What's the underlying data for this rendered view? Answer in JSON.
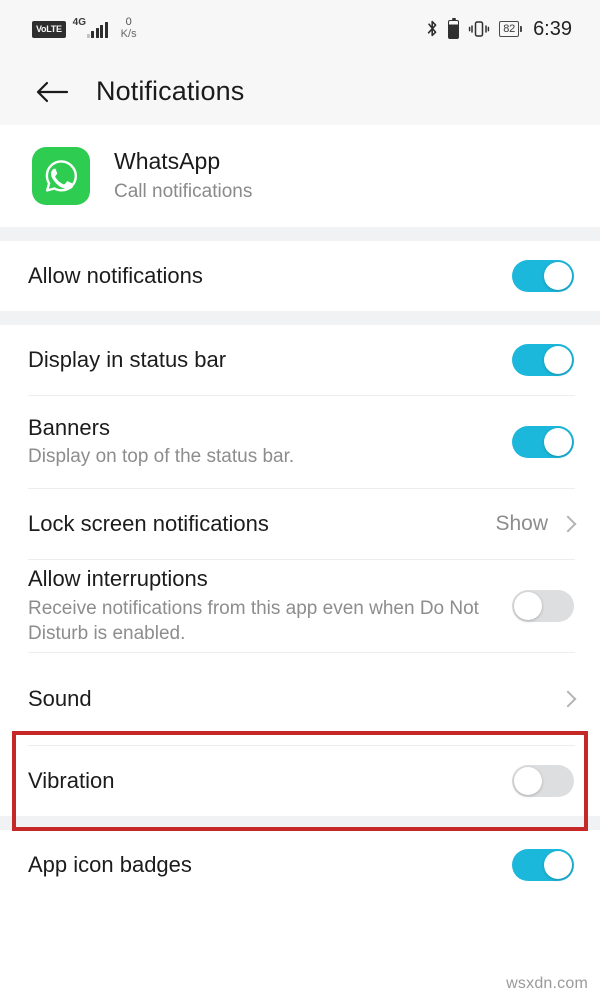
{
  "status_bar": {
    "volte_label": "VoLTE",
    "network_gen": "4G",
    "net_speed_value": "0",
    "net_speed_unit": "K/s",
    "bluetooth_icon": "bluetooth-icon",
    "bt_battery_icon": "bluetooth-device-battery-icon",
    "vibrate_icon": "vibrate-icon",
    "battery_level": "82",
    "time": "6:39"
  },
  "app_bar": {
    "back_icon": "back-arrow-icon",
    "title": "Notifications"
  },
  "app_header": {
    "icon_name": "whatsapp-icon",
    "icon_color": "#2FCC52",
    "name": "WhatsApp",
    "channel": "Call notifications"
  },
  "colors": {
    "toggle_on": "#1CB8DC",
    "toggle_off": "#DCDEE0",
    "highlight": "#C62828",
    "section_gap": "#F1F2F3"
  },
  "groups": [
    {
      "rows": [
        {
          "name": "allow-notifications",
          "title": "Allow notifications",
          "sub": "",
          "control": "toggle",
          "value": "on"
        }
      ]
    },
    {
      "rows": [
        {
          "name": "display-in-status-bar",
          "title": "Display in status bar",
          "sub": "",
          "control": "toggle",
          "value": "on"
        },
        {
          "name": "banners",
          "title": "Banners",
          "sub": "Display on top of the status bar.",
          "control": "toggle",
          "value": "on"
        },
        {
          "name": "lock-screen-notifications",
          "title": "Lock screen notifications",
          "sub": "",
          "control": "value-chevron",
          "value": "Show"
        },
        {
          "name": "allow-interruptions",
          "title": "Allow interruptions",
          "sub": "Receive notifications from this app even when Do Not Disturb is enabled.",
          "control": "toggle",
          "value": "off"
        },
        {
          "name": "sound",
          "title": "Sound",
          "sub": "",
          "control": "chevron",
          "value": "",
          "highlighted": true
        },
        {
          "name": "vibration",
          "title": "Vibration",
          "sub": "",
          "control": "toggle",
          "value": "off"
        }
      ]
    },
    {
      "rows": [
        {
          "name": "app-icon-badges",
          "title": "App icon badges",
          "sub": "",
          "control": "toggle",
          "value": "on"
        }
      ]
    }
  ],
  "watermark": "wsxdn.com"
}
